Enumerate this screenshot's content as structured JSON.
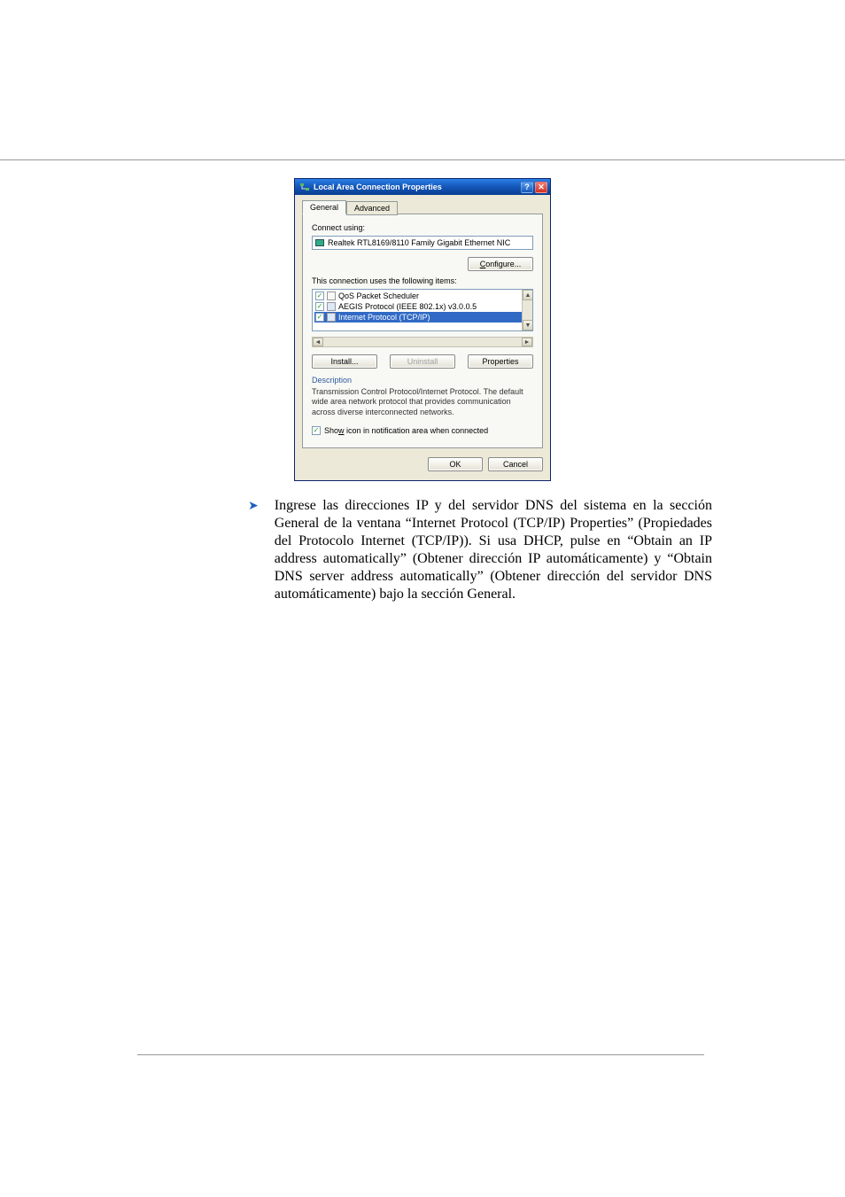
{
  "dialog": {
    "title": "Local Area Connection Properties",
    "tabs": {
      "general": "General",
      "advanced": "Advanced"
    },
    "connect_using_label": "Connect using:",
    "adapter": "Realtek RTL8169/8110 Family Gigabit Ethernet NIC",
    "configure_btn": "Configure...",
    "items_label": "This connection uses the following items:",
    "items": {
      "qos": "QoS Packet Scheduler",
      "aegis": "AEGIS Protocol (IEEE 802.1x) v3.0.0.5",
      "tcpip": "Internet Protocol (TCP/IP)"
    },
    "buttons": {
      "install": "Install...",
      "uninstall": "Uninstall",
      "properties": "Properties"
    },
    "description_label": "Description",
    "description_text": "Transmission Control Protocol/Internet Protocol. The default wide area network protocol that provides communication across diverse interconnected networks.",
    "show_icon": "Show icon in notification area when connected",
    "ok": "OK",
    "cancel": "Cancel"
  },
  "paragraph": "Ingrese las direcciones IP y del servidor DNS del sistema en la sección General de la ventana “Internet Protocol (TCP/IP) Properties” (Propiedades del Protocolo Internet (TCP/IP)).  Si usa DHCP, pulse en “Obtain an IP address automatically” (Obtener dirección IP automáticamente) y “Obtain DNS server address automatically” (Obtener dirección del servidor DNS automáticamente) bajo la sección General."
}
